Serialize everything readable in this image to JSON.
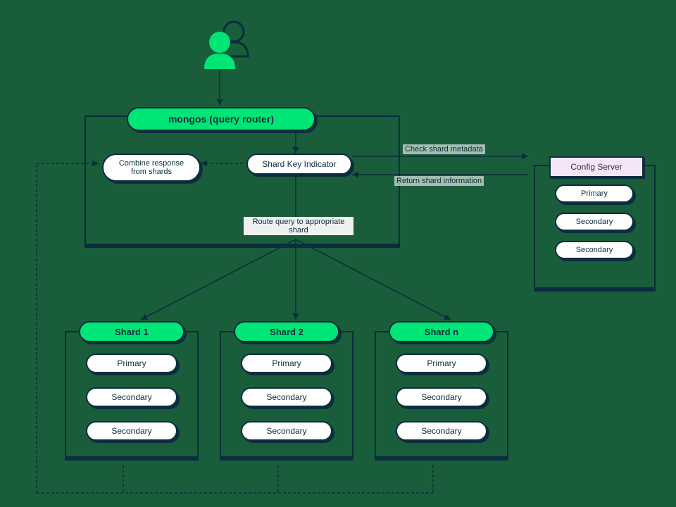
{
  "mongos": {
    "label": "mongos (query router)"
  },
  "combine": {
    "label": "Combine response from shards"
  },
  "shardkey": {
    "label": "Shard Key Indicator"
  },
  "route": {
    "label": "Route query to appropriate shard"
  },
  "checkMeta": {
    "label": "Check shard metadata"
  },
  "returnInfo": {
    "label": "Return shard information"
  },
  "config": {
    "title": "Config Server",
    "members": [
      "Primary",
      "Secondary",
      "Secondary"
    ]
  },
  "shards": [
    {
      "title": "Shard 1",
      "members": [
        "Primary",
        "Secondary",
        "Secondary"
      ]
    },
    {
      "title": "Shard 2",
      "members": [
        "Primary",
        "Secondary",
        "Secondary"
      ]
    },
    {
      "title": "Shard n",
      "members": [
        "Primary",
        "Secondary",
        "Secondary"
      ]
    }
  ]
}
